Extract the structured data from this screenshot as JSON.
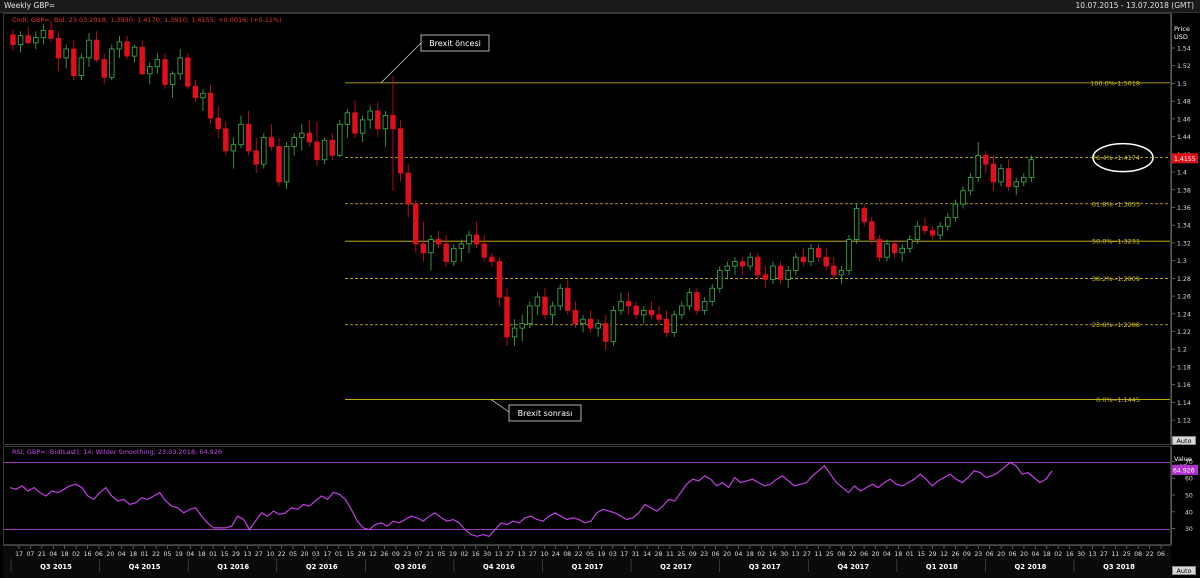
{
  "window": {
    "title": "Weekly GBP=",
    "date_range": "10.07.2015 - 13.07.2018 (GMT)"
  },
  "price_pane": {
    "legend": "Cndl; GBP=; Bid; 23.03.2018; 1.3930; 1.4170; 1.3910; 1.4155; +0.0016; (+0.11%)",
    "axis_title_1": "Price",
    "axis_title_2": "USD",
    "auto_label": "Auto",
    "last_price_tag": "1.4155",
    "y_ticks": [
      "1.1",
      "1.12",
      "1.14",
      "1.16",
      "1.18",
      "1.2",
      "1.22",
      "1.24",
      "1.26",
      "1.28",
      "1.3",
      "1.32",
      "1.34",
      "1.36",
      "1.38",
      "1.4",
      "1.42",
      "1.44",
      "1.46",
      "1.48",
      "1.5",
      "1.52",
      "1.54"
    ],
    "annotation_before": "Brexit öncesi",
    "annotation_after": "Brexit sonrası",
    "fib_levels": [
      {
        "label": "100.0%-1.5018",
        "value": 1.5018,
        "style": "solid"
      },
      {
        "label": "76.4%--1.4174",
        "value": 1.4174,
        "style": "dashed"
      },
      {
        "label": "61.8%--1.3653",
        "value": 1.3653,
        "style": "dashed"
      },
      {
        "label": "50.0%--1.3231",
        "value": 1.3231,
        "style": "solid"
      },
      {
        "label": "38.2%--1.2809",
        "value": 1.2809,
        "style": "dashed"
      },
      {
        "label": "23.6%--1.2288",
        "value": 1.2288,
        "style": "dashed"
      },
      {
        "label": "0.0%--1.1445",
        "value": 1.1445,
        "style": "solid"
      }
    ]
  },
  "rsi_pane": {
    "legend": "RSI; GBP=; Bid(Last); 14; Wilder Smoothing; 23.03.2018; 64.926",
    "axis_title_1": "Value",
    "axis_title_2": "USD",
    "auto_label": "Auto",
    "last_value_tag": "64.926",
    "y_ticks": [
      "30",
      "40",
      "50",
      "60",
      "70"
    ]
  },
  "x_axis": {
    "day_ticks": [
      "17",
      "07",
      "21",
      "04",
      "18",
      "02",
      "16",
      "06",
      "20",
      "04",
      "18",
      "01",
      "22",
      "05",
      "19",
      "04",
      "18",
      "01",
      "15",
      "29",
      "13",
      "27",
      "10",
      "22",
      "05",
      "20",
      "03",
      "17",
      "01",
      "15",
      "29",
      "12",
      "26",
      "09",
      "23",
      "07",
      "21",
      "05",
      "19",
      "02",
      "16",
      "30",
      "13",
      "27",
      "13",
      "27",
      "10",
      "24",
      "08",
      "22",
      "05",
      "19",
      "03",
      "17",
      "31",
      "14",
      "28",
      "11",
      "25",
      "09",
      "23",
      "06",
      "20",
      "04",
      "18",
      "02",
      "16",
      "30",
      "13",
      "27",
      "11",
      "25",
      "08",
      "22",
      "06",
      "20",
      "04",
      "18",
      "01",
      "15",
      "29",
      "12",
      "26",
      "09",
      "23",
      "06",
      "20",
      "06",
      "20",
      "04",
      "18",
      "02",
      "16",
      "30",
      "13",
      "27",
      "11",
      "25",
      "08",
      "22",
      "06"
    ],
    "quarters": [
      "Q3 2015",
      "Q4 2015",
      "Q1 2016",
      "Q2 2016",
      "Q3 2016",
      "Q4 2016",
      "Q1 2017",
      "Q2 2017",
      "Q3 2017",
      "Q4 2017",
      "Q1 2018",
      "Q2 2018",
      "Q3 2018"
    ],
    "auto_label": "Auto"
  },
  "colors": {
    "up_candle": "#3cb34a",
    "down_candle": "#e0101a",
    "fib_line": "#d4c01a",
    "rsi_line": "#c040e0",
    "rsi_bounds": "#b040d0",
    "background": "#000000"
  },
  "chart_data": [
    {
      "type": "candlestick",
      "series_ohlc": [
        [
          1.556,
          1.562,
          1.538,
          1.545
        ],
        [
          1.545,
          1.56,
          1.536,
          1.555
        ],
        [
          1.555,
          1.565,
          1.545,
          1.547
        ],
        [
          1.547,
          1.56,
          1.54,
          1.553
        ],
        [
          1.553,
          1.568,
          1.545,
          1.561
        ],
        [
          1.561,
          1.57,
          1.548,
          1.552
        ],
        [
          1.552,
          1.56,
          1.515,
          1.53
        ],
        [
          1.53,
          1.545,
          1.518,
          1.54
        ],
        [
          1.54,
          1.55,
          1.505,
          1.51
        ],
        [
          1.51,
          1.535,
          1.505,
          1.53
        ],
        [
          1.53,
          1.558,
          1.52,
          1.55
        ],
        [
          1.55,
          1.56,
          1.525,
          1.528
        ],
        [
          1.528,
          1.535,
          1.5,
          1.508
        ],
        [
          1.508,
          1.545,
          1.505,
          1.54
        ],
        [
          1.54,
          1.555,
          1.53,
          1.548
        ],
        [
          1.548,
          1.555,
          1.528,
          1.532
        ],
        [
          1.532,
          1.545,
          1.525,
          1.542
        ],
        [
          1.542,
          1.55,
          1.51,
          1.512
        ],
        [
          1.512,
          1.525,
          1.5,
          1.52
        ],
        [
          1.52,
          1.535,
          1.512,
          1.528
        ],
        [
          1.528,
          1.535,
          1.495,
          1.5
        ],
        [
          1.5,
          1.515,
          1.485,
          1.512
        ],
        [
          1.512,
          1.54,
          1.505,
          1.53
        ],
        [
          1.53,
          1.535,
          1.495,
          1.498
        ],
        [
          1.498,
          1.505,
          1.48,
          1.485
        ],
        [
          1.485,
          1.495,
          1.47,
          1.49
        ],
        [
          1.49,
          1.5,
          1.455,
          1.462
        ],
        [
          1.462,
          1.475,
          1.44,
          1.45
        ],
        [
          1.45,
          1.458,
          1.42,
          1.425
        ],
        [
          1.425,
          1.44,
          1.405,
          1.432
        ],
        [
          1.432,
          1.465,
          1.428,
          1.455
        ],
        [
          1.455,
          1.47,
          1.42,
          1.425
        ],
        [
          1.425,
          1.44,
          1.4,
          1.41
        ],
        [
          1.41,
          1.445,
          1.405,
          1.44
        ],
        [
          1.44,
          1.455,
          1.425,
          1.43
        ],
        [
          1.43,
          1.44,
          1.385,
          1.39
        ],
        [
          1.39,
          1.435,
          1.382,
          1.43
        ],
        [
          1.43,
          1.445,
          1.42,
          1.44
        ],
        [
          1.44,
          1.455,
          1.425,
          1.445
        ],
        [
          1.445,
          1.46,
          1.43,
          1.435
        ],
        [
          1.435,
          1.458,
          1.408,
          1.415
        ],
        [
          1.415,
          1.44,
          1.41,
          1.437
        ],
        [
          1.437,
          1.445,
          1.415,
          1.42
        ],
        [
          1.42,
          1.46,
          1.418,
          1.455
        ],
        [
          1.455,
          1.472,
          1.44,
          1.468
        ],
        [
          1.468,
          1.482,
          1.44,
          1.445
        ],
        [
          1.445,
          1.465,
          1.435,
          1.46
        ],
        [
          1.46,
          1.476,
          1.45,
          1.47
        ],
        [
          1.47,
          1.48,
          1.44,
          1.45
        ],
        [
          1.45,
          1.47,
          1.43,
          1.465
        ],
        [
          1.465,
          1.51,
          1.38,
          1.45
        ],
        [
          1.45,
          1.46,
          1.39,
          1.4
        ],
        [
          1.4,
          1.41,
          1.35,
          1.365
        ],
        [
          1.365,
          1.37,
          1.31,
          1.32
        ],
        [
          1.32,
          1.345,
          1.3,
          1.31
        ],
        [
          1.31,
          1.33,
          1.29,
          1.325
        ],
        [
          1.325,
          1.335,
          1.315,
          1.32
        ],
        [
          1.32,
          1.33,
          1.295,
          1.3
        ],
        [
          1.3,
          1.32,
          1.295,
          1.315
        ],
        [
          1.315,
          1.325,
          1.3,
          1.32
        ],
        [
          1.32,
          1.335,
          1.31,
          1.33
        ],
        [
          1.33,
          1.345,
          1.315,
          1.32
        ],
        [
          1.32,
          1.33,
          1.3,
          1.305
        ],
        [
          1.305,
          1.31,
          1.295,
          1.3
        ],
        [
          1.3,
          1.305,
          1.25,
          1.26
        ],
        [
          1.26,
          1.27,
          1.205,
          1.215
        ],
        [
          1.215,
          1.235,
          1.205,
          1.225
        ],
        [
          1.225,
          1.24,
          1.21,
          1.23
        ],
        [
          1.23,
          1.255,
          1.225,
          1.25
        ],
        [
          1.25,
          1.265,
          1.24,
          1.26
        ],
        [
          1.26,
          1.27,
          1.235,
          1.24
        ],
        [
          1.24,
          1.255,
          1.23,
          1.25
        ],
        [
          1.25,
          1.275,
          1.245,
          1.27
        ],
        [
          1.27,
          1.28,
          1.24,
          1.245
        ],
        [
          1.245,
          1.255,
          1.225,
          1.23
        ],
        [
          1.23,
          1.24,
          1.22,
          1.235
        ],
        [
          1.235,
          1.245,
          1.22,
          1.225
        ],
        [
          1.225,
          1.235,
          1.215,
          1.23
        ],
        [
          1.23,
          1.24,
          1.2,
          1.21
        ],
        [
          1.21,
          1.25,
          1.205,
          1.245
        ],
        [
          1.245,
          1.265,
          1.24,
          1.255
        ],
        [
          1.255,
          1.265,
          1.24,
          1.25
        ],
        [
          1.25,
          1.255,
          1.235,
          1.24
        ],
        [
          1.24,
          1.25,
          1.23,
          1.245
        ],
        [
          1.245,
          1.255,
          1.235,
          1.24
        ],
        [
          1.24,
          1.25,
          1.23,
          1.235
        ],
        [
          1.235,
          1.245,
          1.215,
          1.22
        ],
        [
          1.22,
          1.245,
          1.215,
          1.24
        ],
        [
          1.24,
          1.255,
          1.235,
          1.25
        ],
        [
          1.25,
          1.27,
          1.245,
          1.265
        ],
        [
          1.265,
          1.27,
          1.24,
          1.245
        ],
        [
          1.245,
          1.26,
          1.24,
          1.255
        ],
        [
          1.255,
          1.275,
          1.25,
          1.27
        ],
        [
          1.27,
          1.295,
          1.265,
          1.29
        ],
        [
          1.29,
          1.3,
          1.28,
          1.295
        ],
        [
          1.295,
          1.305,
          1.285,
          1.3
        ],
        [
          1.3,
          1.305,
          1.285,
          1.295
        ],
        [
          1.295,
          1.31,
          1.29,
          1.305
        ],
        [
          1.305,
          1.31,
          1.28,
          1.285
        ],
        [
          1.285,
          1.295,
          1.27,
          1.28
        ],
        [
          1.28,
          1.3,
          1.275,
          1.295
        ],
        [
          1.295,
          1.3,
          1.275,
          1.28
        ],
        [
          1.28,
          1.295,
          1.27,
          1.29
        ],
        [
          1.29,
          1.31,
          1.285,
          1.305
        ],
        [
          1.305,
          1.315,
          1.295,
          1.3
        ],
        [
          1.3,
          1.32,
          1.295,
          1.315
        ],
        [
          1.315,
          1.32,
          1.3,
          1.305
        ],
        [
          1.305,
          1.315,
          1.29,
          1.295
        ],
        [
          1.295,
          1.305,
          1.28,
          1.285
        ],
        [
          1.285,
          1.295,
          1.275,
          1.29
        ],
        [
          1.29,
          1.33,
          1.285,
          1.325
        ],
        [
          1.325,
          1.365,
          1.32,
          1.36
        ],
        [
          1.36,
          1.365,
          1.34,
          1.345
        ],
        [
          1.345,
          1.35,
          1.32,
          1.325
        ],
        [
          1.325,
          1.33,
          1.3,
          1.305
        ],
        [
          1.305,
          1.325,
          1.3,
          1.32
        ],
        [
          1.32,
          1.325,
          1.305,
          1.31
        ],
        [
          1.31,
          1.32,
          1.3,
          1.315
        ],
        [
          1.315,
          1.33,
          1.31,
          1.325
        ],
        [
          1.325,
          1.345,
          1.32,
          1.34
        ],
        [
          1.34,
          1.35,
          1.33,
          1.335
        ],
        [
          1.335,
          1.34,
          1.325,
          1.33
        ],
        [
          1.33,
          1.345,
          1.325,
          1.34
        ],
        [
          1.34,
          1.355,
          1.335,
          1.35
        ],
        [
          1.35,
          1.37,
          1.345,
          1.365
        ],
        [
          1.365,
          1.385,
          1.36,
          1.38
        ],
        [
          1.38,
          1.4,
          1.375,
          1.395
        ],
        [
          1.395,
          1.435,
          1.39,
          1.42
        ],
        [
          1.42,
          1.425,
          1.4,
          1.41
        ],
        [
          1.41,
          1.42,
          1.38,
          1.39
        ],
        [
          1.39,
          1.41,
          1.385,
          1.405
        ],
        [
          1.405,
          1.415,
          1.38,
          1.385
        ],
        [
          1.385,
          1.395,
          1.375,
          1.39
        ],
        [
          1.39,
          1.4,
          1.385,
          1.395
        ],
        [
          1.395,
          1.42,
          1.39,
          1.415
        ]
      ]
    },
    {
      "type": "line",
      "name": "RSI",
      "ylim": [
        25,
        75
      ],
      "values": [
        55,
        54,
        56,
        53,
        55,
        52,
        50,
        53,
        52,
        54,
        56,
        57,
        55,
        50,
        48,
        52,
        55,
        50,
        47,
        48,
        45,
        46,
        49,
        48,
        50,
        52,
        47,
        44,
        43,
        40,
        42,
        43,
        38,
        34,
        31,
        31,
        31,
        32,
        38,
        36,
        30,
        35,
        40,
        38,
        41,
        39,
        40,
        43,
        42,
        45,
        44,
        47,
        50,
        48,
        52,
        51,
        48,
        42,
        35,
        31,
        30,
        33,
        34,
        32,
        35,
        34,
        36,
        38,
        37,
        35,
        38,
        40,
        37,
        35,
        36,
        34,
        30,
        27,
        26,
        27,
        26,
        30,
        34,
        33,
        35,
        34,
        37,
        38,
        36,
        35,
        38,
        40,
        38,
        36,
        37,
        36,
        34,
        35,
        40,
        42,
        41,
        40,
        38,
        36,
        37,
        40,
        45,
        43,
        41,
        44,
        48,
        47,
        52,
        57,
        60,
        59,
        62,
        60,
        56,
        58,
        55,
        61,
        58,
        59,
        60,
        58,
        56,
        57,
        60,
        62,
        59,
        56,
        57,
        58,
        62,
        65,
        68,
        63,
        58,
        55,
        52,
        56,
        53,
        55,
        57,
        55,
        58,
        60,
        57,
        56,
        58,
        60,
        63,
        60,
        56,
        59,
        61,
        63,
        60,
        58,
        61,
        65,
        64,
        61,
        62,
        64,
        67,
        70,
        68,
        63,
        64,
        61,
        58,
        60,
        64.926
      ]
    }
  ]
}
